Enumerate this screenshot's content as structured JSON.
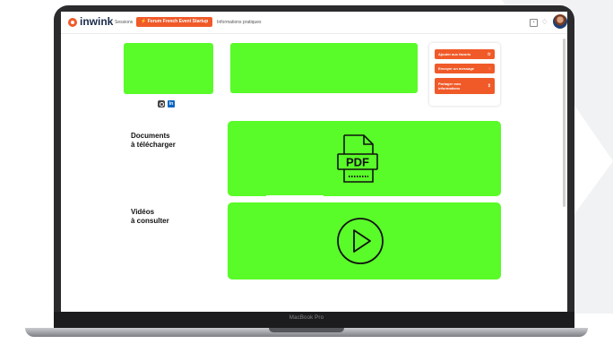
{
  "app": {
    "logo_text": "inwink",
    "nav": {
      "sessions": "Sessions",
      "active_tab": "Forum French Event Startup",
      "practical_info": "Informations pratiques"
    }
  },
  "actions": {
    "favorite": "Ajouter aux favoris",
    "message": "Envoyer un message",
    "share": "Partager mes informations"
  },
  "sections": {
    "documents": {
      "line1": "Documents",
      "line2": "à télécharger",
      "icon_text": "PDF"
    },
    "videos": {
      "line1": "Vidéos",
      "line2": "à consulter"
    }
  },
  "device": {
    "label": "MacBook Pro"
  },
  "colors": {
    "accent": "#f05a28",
    "placeholder": "#59fb28",
    "brand_dark": "#1b2b4b"
  },
  "icons": [
    "logo-icon",
    "calendar-icon",
    "bell-icon",
    "avatar",
    "instagram-icon",
    "linkedin-icon",
    "star-icon",
    "chat-icon",
    "share-icon",
    "pdf-file-icon",
    "play-icon"
  ]
}
